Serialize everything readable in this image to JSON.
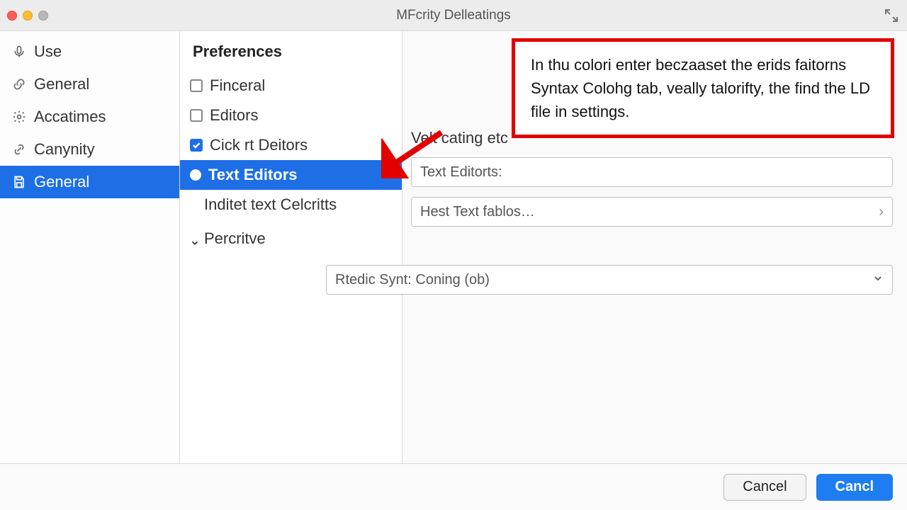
{
  "window": {
    "title": "MFcrity Delleatings"
  },
  "sidebar": {
    "items": [
      {
        "label": "Use"
      },
      {
        "label": "General"
      },
      {
        "label": "Accatimes"
      },
      {
        "label": "Canynity"
      },
      {
        "label": "General"
      }
    ]
  },
  "preferences": {
    "heading": "Preferences",
    "items": [
      {
        "label": "Finceral",
        "checked": false
      },
      {
        "label": "Editors",
        "checked": false
      },
      {
        "label": "Cick rt Deitors",
        "checked": true
      },
      {
        "label": "Text Editors",
        "selected": true
      },
      {
        "label": "Inditet text Celcritts"
      }
    ],
    "group": "Percritve"
  },
  "content": {
    "topLabel": "Velt cating etc",
    "field1": "Text Editorts:",
    "field2": "Hest Text fablos…",
    "dropdown": "Rtedic Synt: Coning (ob)"
  },
  "callout": {
    "text": "In thu colori enter beczaaset the erids faitorns Syntax Colohg tab, veally talorifty, the find the LD file in settings."
  },
  "footer": {
    "cancel": "Cancel",
    "confirm": "Cancl"
  }
}
